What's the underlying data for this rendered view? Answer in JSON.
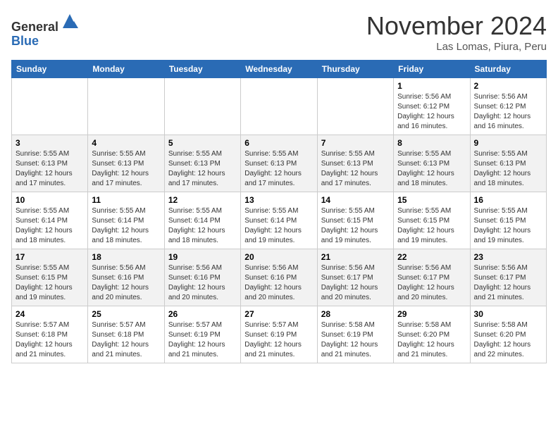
{
  "logo": {
    "line1": "General",
    "line2": "Blue"
  },
  "header": {
    "month": "November 2024",
    "location": "Las Lomas, Piura, Peru"
  },
  "weekdays": [
    "Sunday",
    "Monday",
    "Tuesday",
    "Wednesday",
    "Thursday",
    "Friday",
    "Saturday"
  ],
  "weeks": [
    [
      {
        "day": "",
        "info": ""
      },
      {
        "day": "",
        "info": ""
      },
      {
        "day": "",
        "info": ""
      },
      {
        "day": "",
        "info": ""
      },
      {
        "day": "",
        "info": ""
      },
      {
        "day": "1",
        "info": "Sunrise: 5:56 AM\nSunset: 6:12 PM\nDaylight: 12 hours\nand 16 minutes."
      },
      {
        "day": "2",
        "info": "Sunrise: 5:56 AM\nSunset: 6:12 PM\nDaylight: 12 hours\nand 16 minutes."
      }
    ],
    [
      {
        "day": "3",
        "info": "Sunrise: 5:55 AM\nSunset: 6:13 PM\nDaylight: 12 hours\nand 17 minutes."
      },
      {
        "day": "4",
        "info": "Sunrise: 5:55 AM\nSunset: 6:13 PM\nDaylight: 12 hours\nand 17 minutes."
      },
      {
        "day": "5",
        "info": "Sunrise: 5:55 AM\nSunset: 6:13 PM\nDaylight: 12 hours\nand 17 minutes."
      },
      {
        "day": "6",
        "info": "Sunrise: 5:55 AM\nSunset: 6:13 PM\nDaylight: 12 hours\nand 17 minutes."
      },
      {
        "day": "7",
        "info": "Sunrise: 5:55 AM\nSunset: 6:13 PM\nDaylight: 12 hours\nand 17 minutes."
      },
      {
        "day": "8",
        "info": "Sunrise: 5:55 AM\nSunset: 6:13 PM\nDaylight: 12 hours\nand 18 minutes."
      },
      {
        "day": "9",
        "info": "Sunrise: 5:55 AM\nSunset: 6:13 PM\nDaylight: 12 hours\nand 18 minutes."
      }
    ],
    [
      {
        "day": "10",
        "info": "Sunrise: 5:55 AM\nSunset: 6:14 PM\nDaylight: 12 hours\nand 18 minutes."
      },
      {
        "day": "11",
        "info": "Sunrise: 5:55 AM\nSunset: 6:14 PM\nDaylight: 12 hours\nand 18 minutes."
      },
      {
        "day": "12",
        "info": "Sunrise: 5:55 AM\nSunset: 6:14 PM\nDaylight: 12 hours\nand 18 minutes."
      },
      {
        "day": "13",
        "info": "Sunrise: 5:55 AM\nSunset: 6:14 PM\nDaylight: 12 hours\nand 19 minutes."
      },
      {
        "day": "14",
        "info": "Sunrise: 5:55 AM\nSunset: 6:15 PM\nDaylight: 12 hours\nand 19 minutes."
      },
      {
        "day": "15",
        "info": "Sunrise: 5:55 AM\nSunset: 6:15 PM\nDaylight: 12 hours\nand 19 minutes."
      },
      {
        "day": "16",
        "info": "Sunrise: 5:55 AM\nSunset: 6:15 PM\nDaylight: 12 hours\nand 19 minutes."
      }
    ],
    [
      {
        "day": "17",
        "info": "Sunrise: 5:55 AM\nSunset: 6:15 PM\nDaylight: 12 hours\nand 19 minutes."
      },
      {
        "day": "18",
        "info": "Sunrise: 5:56 AM\nSunset: 6:16 PM\nDaylight: 12 hours\nand 20 minutes."
      },
      {
        "day": "19",
        "info": "Sunrise: 5:56 AM\nSunset: 6:16 PM\nDaylight: 12 hours\nand 20 minutes."
      },
      {
        "day": "20",
        "info": "Sunrise: 5:56 AM\nSunset: 6:16 PM\nDaylight: 12 hours\nand 20 minutes."
      },
      {
        "day": "21",
        "info": "Sunrise: 5:56 AM\nSunset: 6:17 PM\nDaylight: 12 hours\nand 20 minutes."
      },
      {
        "day": "22",
        "info": "Sunrise: 5:56 AM\nSunset: 6:17 PM\nDaylight: 12 hours\nand 20 minutes."
      },
      {
        "day": "23",
        "info": "Sunrise: 5:56 AM\nSunset: 6:17 PM\nDaylight: 12 hours\nand 21 minutes."
      }
    ],
    [
      {
        "day": "24",
        "info": "Sunrise: 5:57 AM\nSunset: 6:18 PM\nDaylight: 12 hours\nand 21 minutes."
      },
      {
        "day": "25",
        "info": "Sunrise: 5:57 AM\nSunset: 6:18 PM\nDaylight: 12 hours\nand 21 minutes."
      },
      {
        "day": "26",
        "info": "Sunrise: 5:57 AM\nSunset: 6:19 PM\nDaylight: 12 hours\nand 21 minutes."
      },
      {
        "day": "27",
        "info": "Sunrise: 5:57 AM\nSunset: 6:19 PM\nDaylight: 12 hours\nand 21 minutes."
      },
      {
        "day": "28",
        "info": "Sunrise: 5:58 AM\nSunset: 6:19 PM\nDaylight: 12 hours\nand 21 minutes."
      },
      {
        "day": "29",
        "info": "Sunrise: 5:58 AM\nSunset: 6:20 PM\nDaylight: 12 hours\nand 21 minutes."
      },
      {
        "day": "30",
        "info": "Sunrise: 5:58 AM\nSunset: 6:20 PM\nDaylight: 12 hours\nand 22 minutes."
      }
    ]
  ]
}
